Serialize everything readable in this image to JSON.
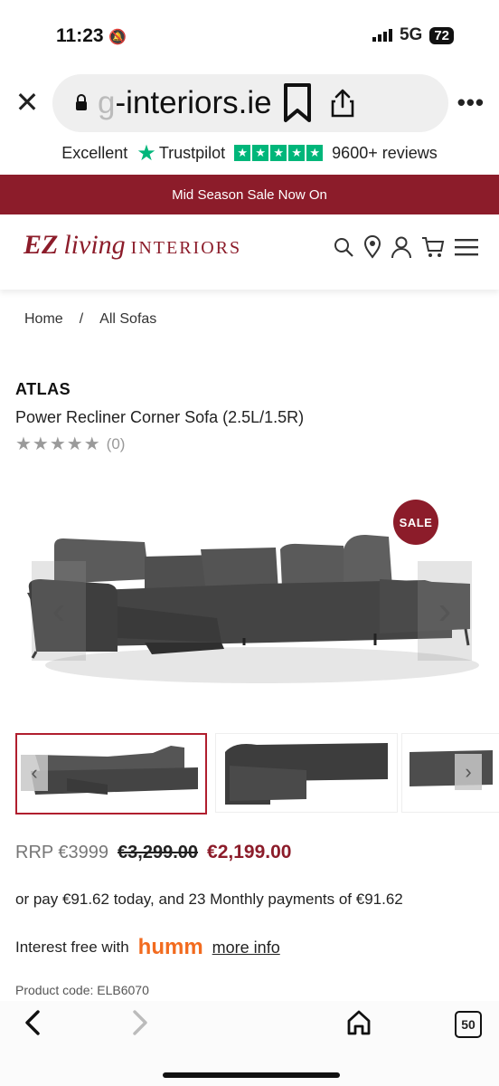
{
  "status": {
    "time": "11:23",
    "network": "5G",
    "battery": "72"
  },
  "browser": {
    "url_fade": "g",
    "url_rest": "-interiors.ie",
    "more": "•••",
    "tabs_count": "50"
  },
  "trustpilot": {
    "rating_word": "Excellent",
    "brand": "Trustpilot",
    "reviews": "9600+ reviews"
  },
  "banner": {
    "text": "Mid Season Sale Now On"
  },
  "logo": {
    "ez": "EZ",
    "living": "living",
    "interiors": "INTERIORS"
  },
  "breadcrumb": {
    "home": "Home",
    "sep": "/",
    "current": "All Sofas"
  },
  "product": {
    "brand": "ATLAS",
    "name": "Power Recliner Corner Sofa (2.5L/1.5R)",
    "stars": "★★★★★",
    "review_count": "(0)",
    "sale_badge": "SALE"
  },
  "price": {
    "rrp": "RRP €3999",
    "was": "€3,299.00",
    "now": "€2,199.00"
  },
  "finance": {
    "text": "or pay €91.62 today, and 23 Monthly payments of €91.62",
    "interest_label": "Interest free with",
    "provider": "humm",
    "more_info": "more info"
  },
  "product_code": "Product code: ELB6070",
  "colors": {
    "brand": "#8c1c2a",
    "trustpilot": "#00b67a",
    "humm": "#f26b1f"
  }
}
